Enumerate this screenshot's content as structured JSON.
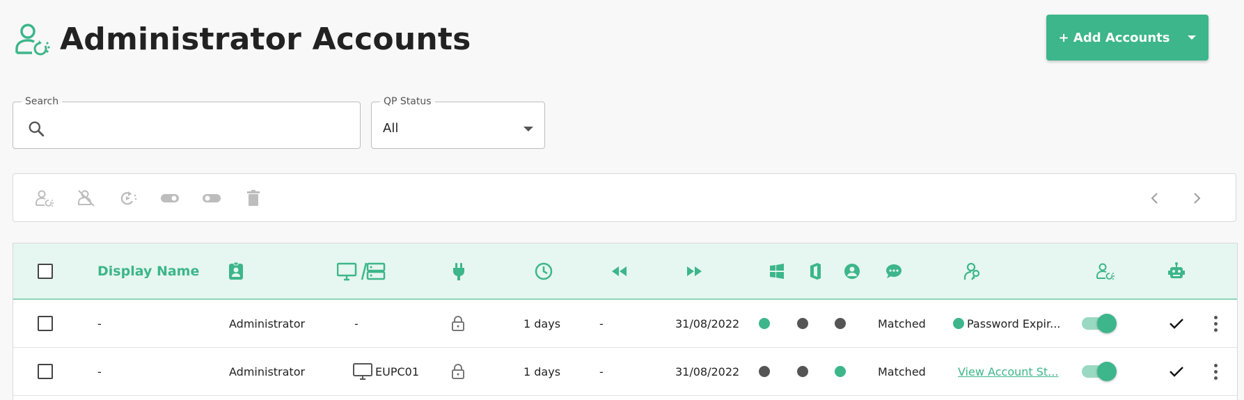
{
  "page": {
    "title": "Administrator Accounts"
  },
  "header": {
    "add_button_label": "+ Add Accounts"
  },
  "filters": {
    "search": {
      "label": "Search",
      "value": "",
      "placeholder": ""
    },
    "qp_status": {
      "label": "QP Status",
      "value": "All"
    }
  },
  "toolbar": {
    "icons": [
      "user-sync-icon",
      "user-disabled-icon",
      "refresh-icon",
      "toggle-on-icon",
      "toggle-off-icon",
      "trash-icon"
    ],
    "pager": [
      "chevron-left-icon",
      "chevron-right-icon"
    ]
  },
  "table": {
    "columns": [
      {
        "key": "select",
        "icon": "checkbox"
      },
      {
        "key": "display_name",
        "label": "Display Name"
      },
      {
        "key": "account",
        "icon": "badge-icon"
      },
      {
        "key": "machine",
        "icon": "monitor-server-icon"
      },
      {
        "key": "connection",
        "icon": "plug-icon"
      },
      {
        "key": "age",
        "icon": "clock-icon"
      },
      {
        "key": "rewind",
        "icon": "rewind-icon"
      },
      {
        "key": "forward",
        "icon": "fast-forward-icon"
      },
      {
        "key": "windows",
        "icon": "windows-icon"
      },
      {
        "key": "office",
        "icon": "office-icon"
      },
      {
        "key": "user",
        "icon": "user-circle-icon"
      },
      {
        "key": "chat",
        "icon": "chat-icon"
      },
      {
        "key": "account_status",
        "icon": "key-user-icon"
      },
      {
        "key": "sync",
        "icon": "user-sync-icon"
      },
      {
        "key": "automation",
        "icon": "robot-icon"
      }
    ],
    "rows": [
      {
        "display_name": "-",
        "account": "Administrator",
        "machine": "-",
        "machine_icon": false,
        "age": "1 days",
        "rewind": "-",
        "date": "31/08/2022",
        "windows": "green",
        "office": "gray",
        "user": "gray",
        "match": "Matched",
        "status_text": "Password Expir...",
        "status_dot": "green",
        "status_link": false,
        "enabled": true
      },
      {
        "display_name": "-",
        "account": "Administrator",
        "machine": "EUPC01",
        "machine_icon": true,
        "age": "1 days",
        "rewind": "-",
        "date": "31/08/2022",
        "windows": "gray",
        "office": "gray",
        "user": "green",
        "match": "Matched",
        "status_text": "View Account St...",
        "status_dot": "",
        "status_link": true,
        "enabled": true
      }
    ]
  },
  "colors": {
    "accent": "#3cb68a",
    "header_bg": "#e6f6f0",
    "dot_gray": "#555555"
  }
}
